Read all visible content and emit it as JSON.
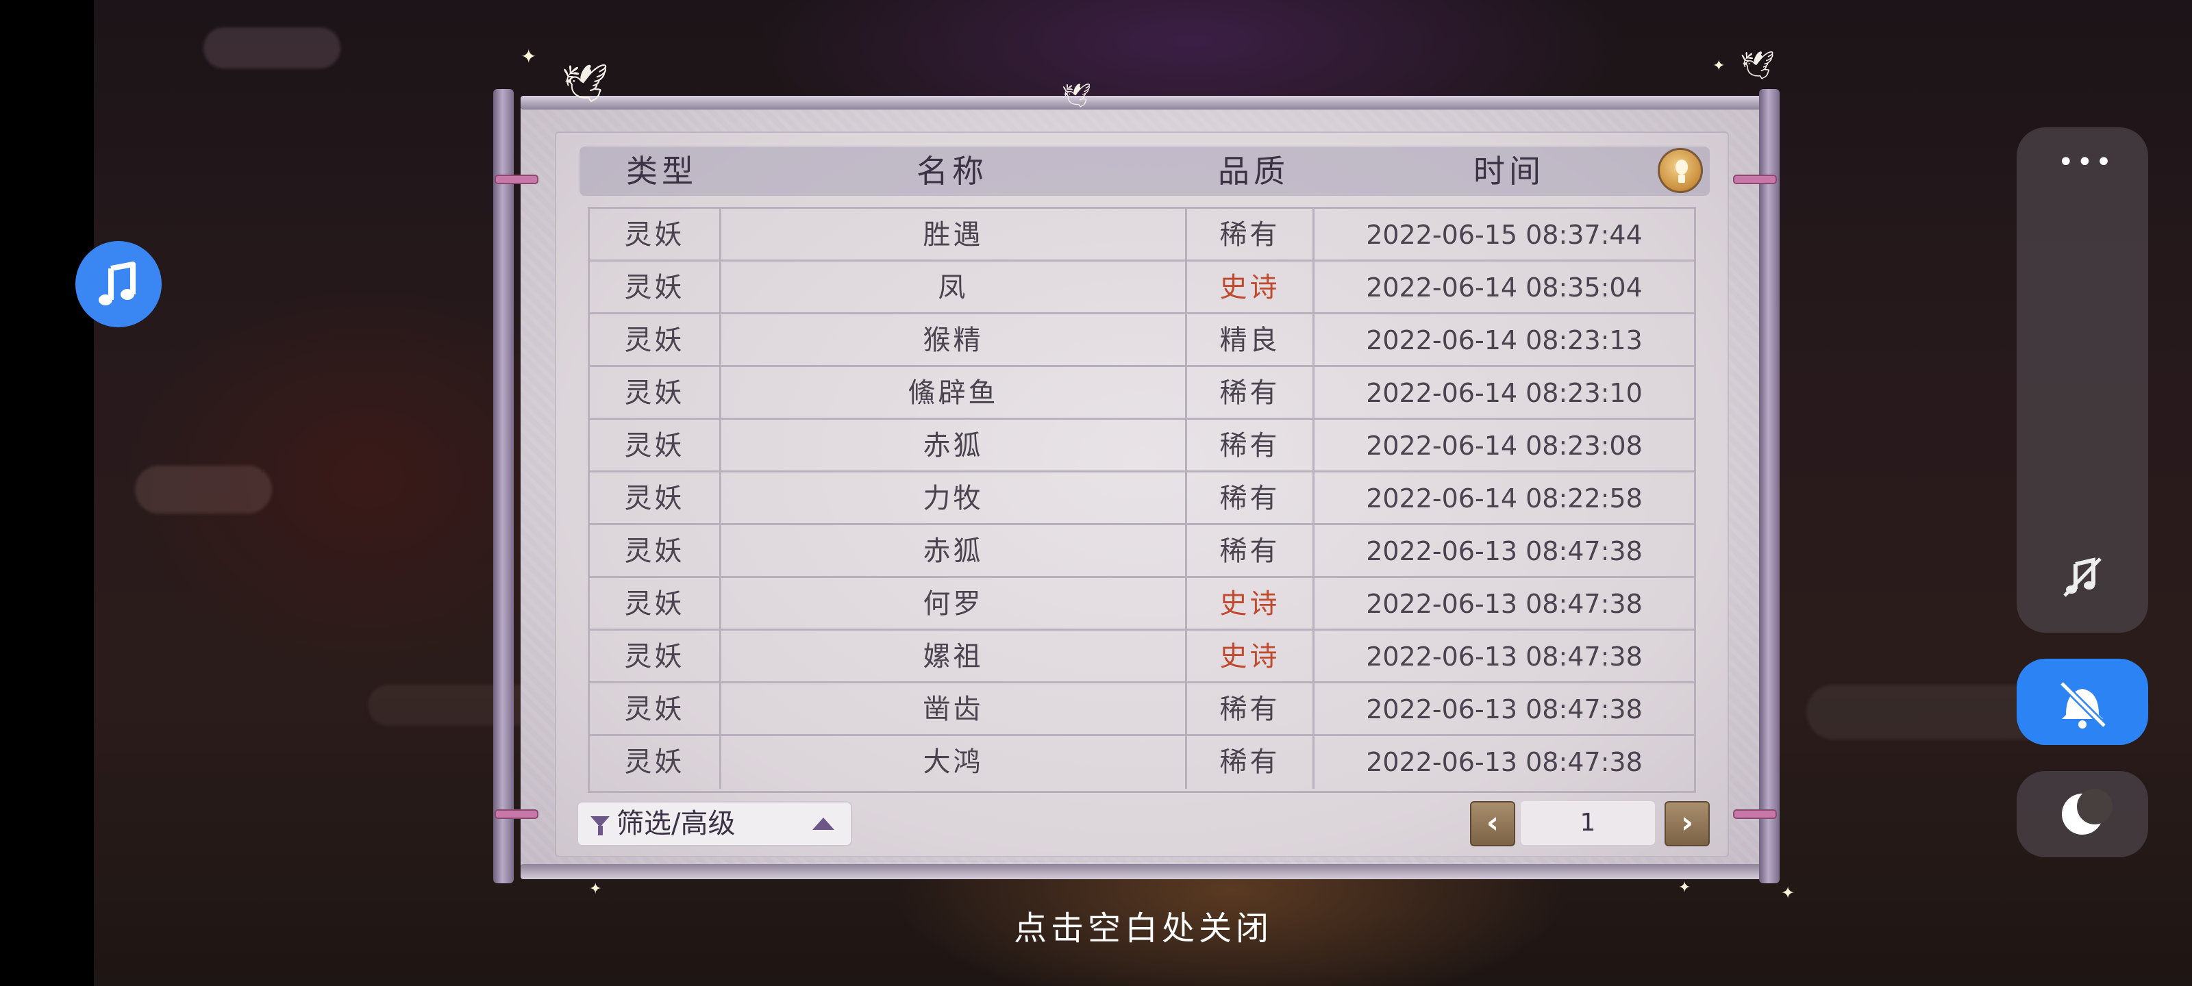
{
  "scroll": {
    "headers": [
      "类型",
      "名称",
      "品质",
      "时间"
    ],
    "rows": [
      {
        "type": "灵妖",
        "name": "胜遇",
        "quality": "稀有",
        "time": "2022-06-15  08:37:44"
      },
      {
        "type": "灵妖",
        "name": "凤",
        "quality": "史诗",
        "time": "2022-06-14  08:35:04"
      },
      {
        "type": "灵妖",
        "name": "猴精",
        "quality": "精良",
        "time": "2022-06-14  08:23:13"
      },
      {
        "type": "灵妖",
        "name": "鯈辟鱼",
        "quality": "稀有",
        "time": "2022-06-14  08:23:10"
      },
      {
        "type": "灵妖",
        "name": "赤狐",
        "quality": "稀有",
        "time": "2022-06-14  08:23:08"
      },
      {
        "type": "灵妖",
        "name": "力牧",
        "quality": "稀有",
        "time": "2022-06-14  08:22:58"
      },
      {
        "type": "灵妖",
        "name": "赤狐",
        "quality": "稀有",
        "time": "2022-06-13  08:47:38"
      },
      {
        "type": "灵妖",
        "name": "何罗",
        "quality": "史诗",
        "time": "2022-06-13  08:47:38"
      },
      {
        "type": "灵妖",
        "name": "嫘祖",
        "quality": "史诗",
        "time": "2022-06-13  08:47:38"
      },
      {
        "type": "灵妖",
        "name": "凿齿",
        "quality": "稀有",
        "time": "2022-06-13  08:47:38"
      },
      {
        "type": "灵妖",
        "name": "大鸿",
        "quality": "稀有",
        "time": "2022-06-13  08:47:38"
      }
    ],
    "filter_label": "筛选/高级",
    "page_number": "1",
    "prev_glyph": "‹",
    "next_glyph": "›",
    "close_hint": "点击空白处关闭"
  },
  "overlay": {
    "menu_glyph": "•••",
    "icons": [
      "music-note-icon",
      "music-off-icon",
      "bell-off-icon",
      "moon-icon",
      "info-bulb-icon",
      "filter-icon"
    ]
  },
  "colors": {
    "epic": "#c04a2e",
    "normal_text": "#4a4450",
    "accent_blue": "#2b83f4"
  }
}
